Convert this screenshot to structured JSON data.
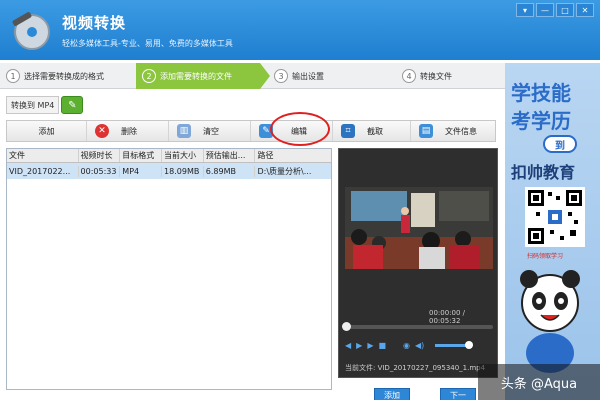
{
  "window": {
    "title": "视频转换",
    "subtitle": "轻松多媒体工具-专业、易用、免费的多媒体工具",
    "buttons": [
      "▾",
      "—",
      "□",
      "✕"
    ]
  },
  "steps": [
    {
      "num": "1",
      "label": "选择需要转换成的格式"
    },
    {
      "num": "2",
      "label": "添加需要转换的文件"
    },
    {
      "num": "3",
      "label": "输出设置"
    },
    {
      "num": "4",
      "label": "转换文件"
    }
  ],
  "convert_to": {
    "label": "转换到 MP4"
  },
  "toolbar": {
    "add": "添加",
    "delete": "删除",
    "clear": "清空",
    "edit": "编辑",
    "crop": "截取",
    "file_info": "文件信息"
  },
  "table": {
    "headers": [
      "文件",
      "视频时长",
      "目标格式",
      "当前大小",
      "预估输出...",
      "路径"
    ],
    "rows": [
      [
        "VID_2017022...",
        "00:05:33",
        "MP4",
        "18.09MB",
        "6.89MB",
        "D:\\质量分析\\..."
      ]
    ]
  },
  "preview": {
    "time": "00:00:00 / 00:05:32",
    "current_file": "当前文件: VID_20170227_095340_1.mp4"
  },
  "bottom": {
    "btn1": "添加",
    "btn2": "下一"
  },
  "ad": {
    "line1": "学技能",
    "line2": "考学历",
    "dao": "到",
    "line3": "扣帅教育",
    "qr_caption": "扫码领取学习"
  },
  "watermark": "头条 @Aqua",
  "colors": {
    "titlebar": "#2a8ad8",
    "active_step": "#8cc63f",
    "selection": "#cfe3f7",
    "highlight": "#e02020"
  }
}
